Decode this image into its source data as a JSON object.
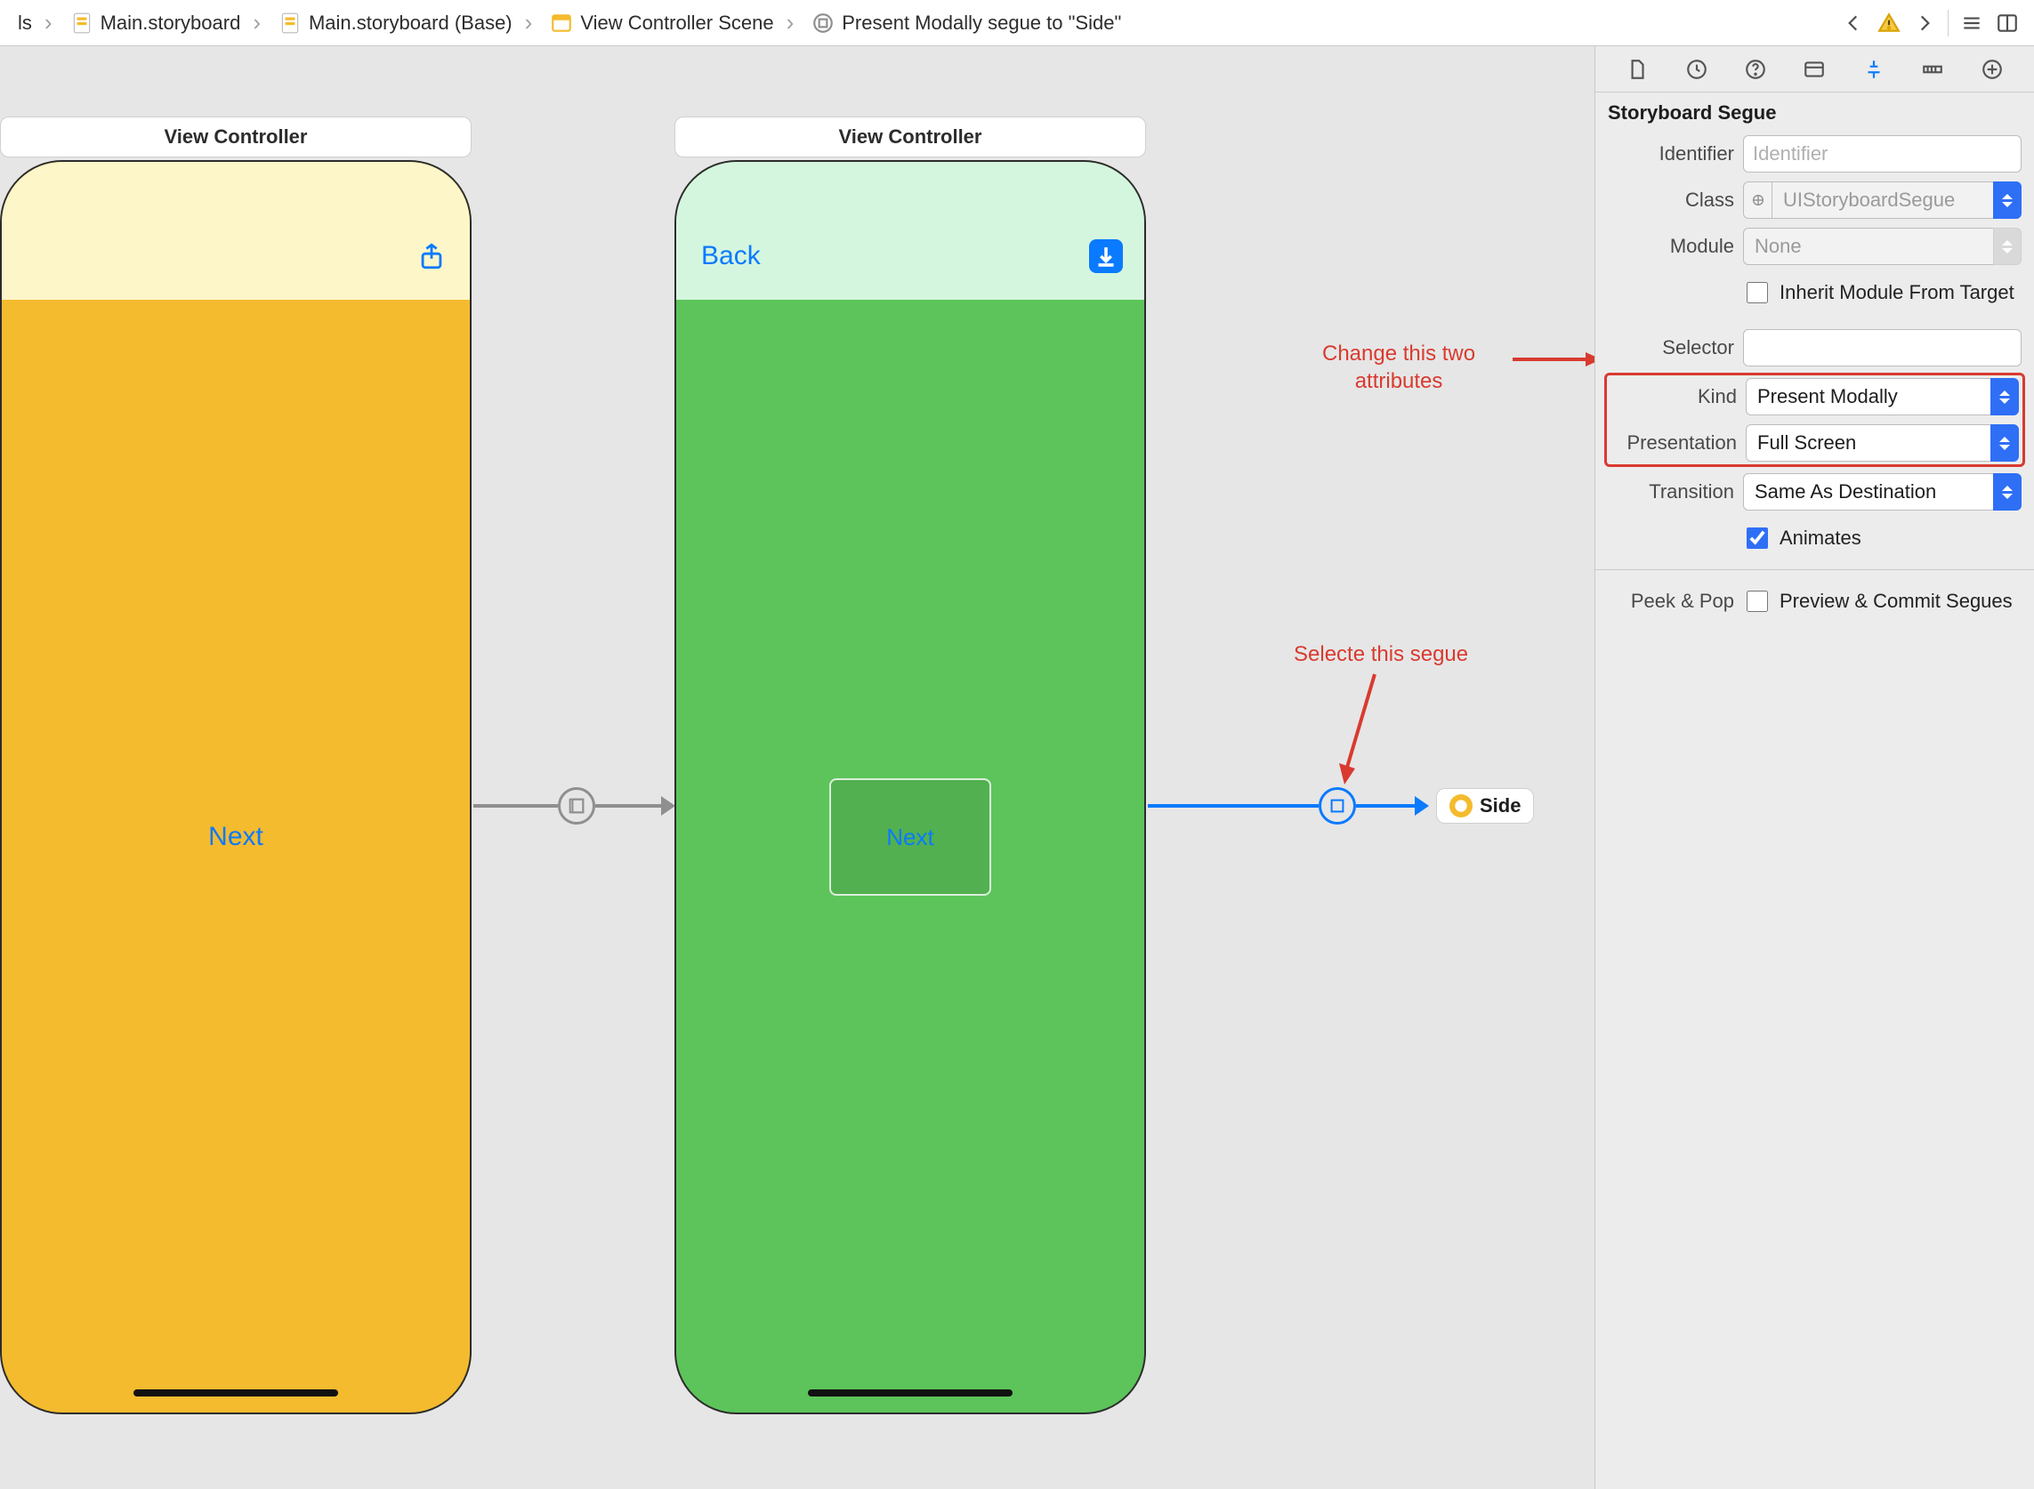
{
  "breadcrumbs": {
    "b0": "ls",
    "b1": "Main.storyboard",
    "b2": "Main.storyboard (Base)",
    "b3": "View Controller Scene",
    "b4": "Present Modally segue to \"Side\""
  },
  "scenes": {
    "vc1_title": "View Controller",
    "vc1_button": "Next",
    "vc2_title": "View Controller",
    "vc2_back": "Back",
    "vc2_button": "Next",
    "side_label": "Side"
  },
  "annotations": {
    "a1": "Change this two\nattributes",
    "a2": "Selecte this segue"
  },
  "inspector": {
    "header": "Storyboard Segue",
    "identifier_label": "Identifier",
    "identifier_placeholder": "Identifier",
    "identifier_value": "",
    "class_label": "Class",
    "class_value": "UIStoryboardSegue",
    "module_label": "Module",
    "module_value": "None",
    "inherit_label": "Inherit Module From Target",
    "inherit_checked": false,
    "selector_label": "Selector",
    "selector_value": "",
    "kind_label": "Kind",
    "kind_value": "Present Modally",
    "presentation_label": "Presentation",
    "presentation_value": "Full Screen",
    "transition_label": "Transition",
    "transition_value": "Same As Destination",
    "animates_label": "Animates",
    "animates_checked": true,
    "peekpop_label": "Peek & Pop",
    "peekpop_option": "Preview & Commit Segues",
    "peekpop_checked": false
  }
}
